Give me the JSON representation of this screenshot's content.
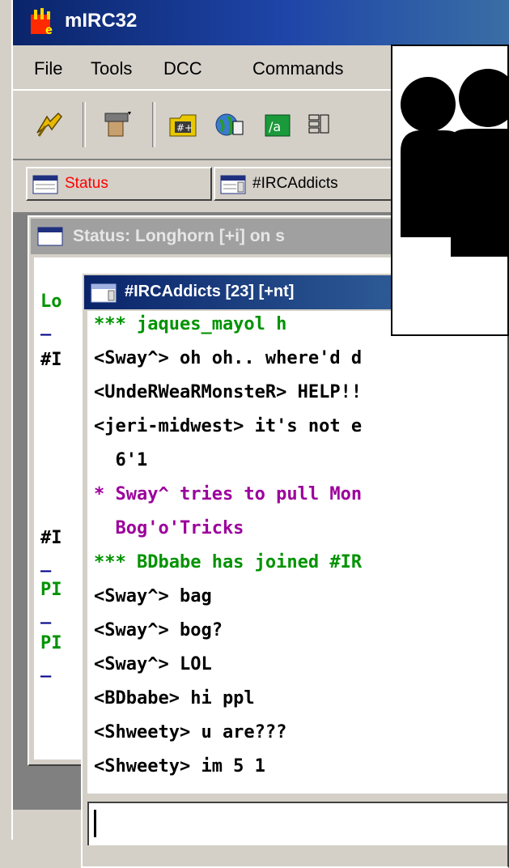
{
  "window": {
    "title": "mIRC32"
  },
  "menu": {
    "items": [
      "File",
      "Tools",
      "DCC",
      "Commands"
    ]
  },
  "switchbar": {
    "buttons": [
      {
        "label": "Status",
        "color": "#ff0000"
      },
      {
        "label": "#IRCAddicts",
        "color": "#000000"
      }
    ]
  },
  "status_window": {
    "title": "Status: Longhorn [+i] on s",
    "lines": [
      "Lo",
      "_",
      "#I",
      "#I",
      "_",
      "PI",
      "_",
      "PI",
      "_"
    ]
  },
  "channel_window": {
    "title": "#IRCAddicts [23] [+nt]",
    "messages": [
      "*** jaques_mayol h",
      "<Sway^> oh oh.. where'd d",
      "<UndeRWeaRMonsteR> HELP!!",
      "<jeri-midwest> it's not e",
      "  6'1",
      "* Sway^ tries to pull Mon",
      "  Bog'o'Tricks",
      "*** BDbabe has joined #IR",
      "<Sway^> bag",
      "<Sway^> bog?",
      "<Sway^> LOL",
      "<BDbabe> hi ppl",
      "<Shweety> u are???",
      "<Shweety> im 5 1"
    ],
    "input_value": ""
  },
  "colors": {
    "join": "#009300",
    "action": "#9c009c",
    "title_active": "#0a246a"
  }
}
